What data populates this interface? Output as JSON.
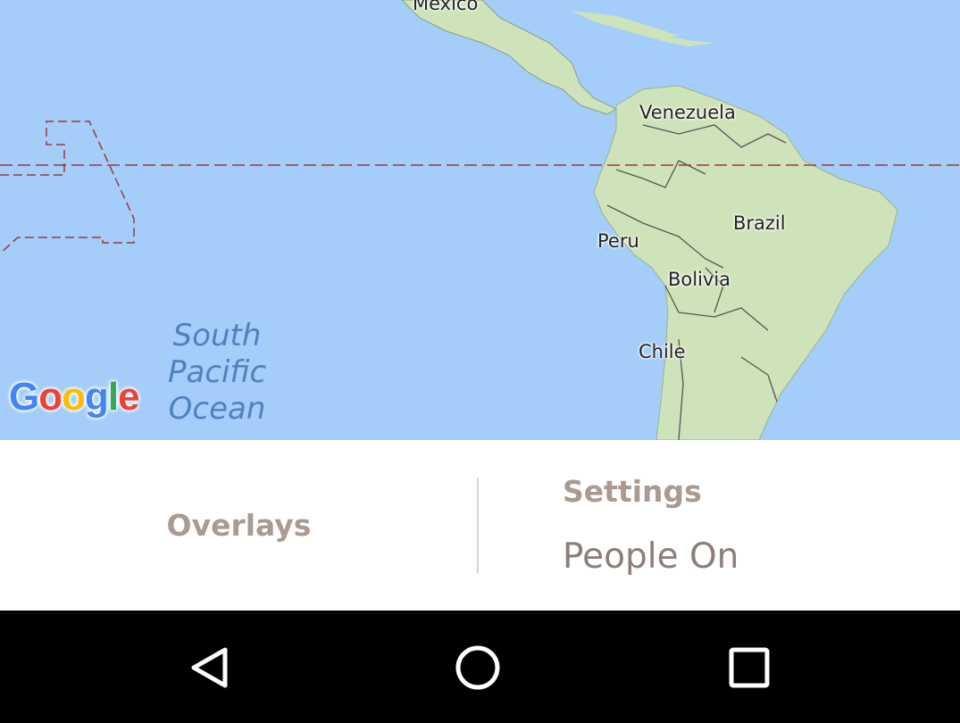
{
  "map": {
    "labels": {
      "mexico": "Mexico",
      "venezuela": "Venezuela",
      "brazil": "Brazil",
      "peru": "Peru",
      "bolivia": "Bolivia",
      "chile": "Chile"
    },
    "ocean": [
      "South",
      "Pacific",
      "Ocean"
    ],
    "logo": [
      "G",
      "o",
      "o",
      "g",
      "l",
      "e"
    ],
    "colors": {
      "water": "#a4cdfa",
      "land": "#cfe3ba",
      "border": "#555555",
      "equator": "#9c3a3a"
    }
  },
  "panel": {
    "overlays_label": "Overlays",
    "settings_title": "Settings",
    "settings_value": "People On"
  },
  "navbar": {
    "back_icon": "back-triangle-icon",
    "home_icon": "home-circle-icon",
    "recent_icon": "recent-apps-square-icon"
  }
}
